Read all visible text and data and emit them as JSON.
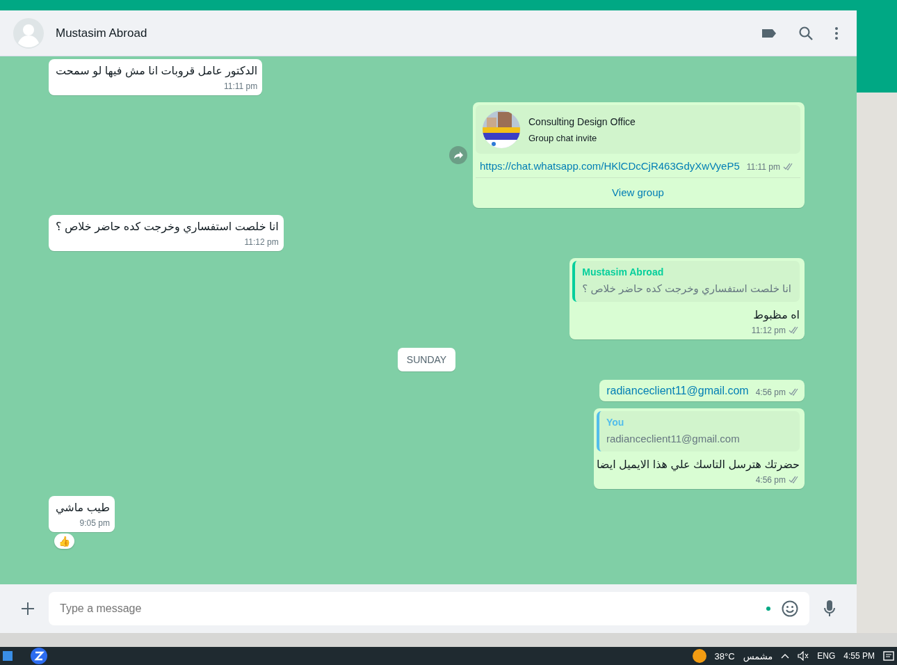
{
  "header": {
    "contact_name": "Mustasim Abroad"
  },
  "messages": [
    {
      "kind": "incoming",
      "text": "الدكتور عامل قروبات انا مش فيها لو سمحت",
      "time": "11:11 pm"
    },
    {
      "kind": "invite",
      "group_name": "Consulting Design Office",
      "subtitle": "Group chat invite",
      "link": "https://chat.whatsapp.com/HKlCDcCjR463GdyXwVyeP5",
      "time": "11:11 pm",
      "action": "View group"
    },
    {
      "kind": "incoming",
      "text": "انا خلصت استفساري وخرجت كده حاضر خلاص ؟",
      "time": "11:12 pm"
    },
    {
      "kind": "quote",
      "quote_author": "Mustasim Abroad",
      "quote_text": "انا خلصت استفساري وخرجت كده حاضر خلاص ؟",
      "text": "اه مظبوط",
      "time": "11:12 pm"
    },
    {
      "kind": "date",
      "text": "SUNDAY"
    },
    {
      "kind": "outgoing-link",
      "text": "radianceclient11@gmail.com",
      "time": "4:56 pm"
    },
    {
      "kind": "quote",
      "quote_author": "You",
      "quote_text": "radianceclient11@gmail.com",
      "text": "حضرتك هترسل التاسك علي هذا الايميل ايضا",
      "time": "4:56 pm"
    },
    {
      "kind": "incoming",
      "text": "طيب ماشي",
      "time": "9:05 pm",
      "reaction": "👍"
    }
  ],
  "composer": {
    "placeholder": "Type a message"
  },
  "taskbar": {
    "temperature": "38°C",
    "weather": "مشمس",
    "language": "ENG",
    "time": "4:55 PM"
  }
}
